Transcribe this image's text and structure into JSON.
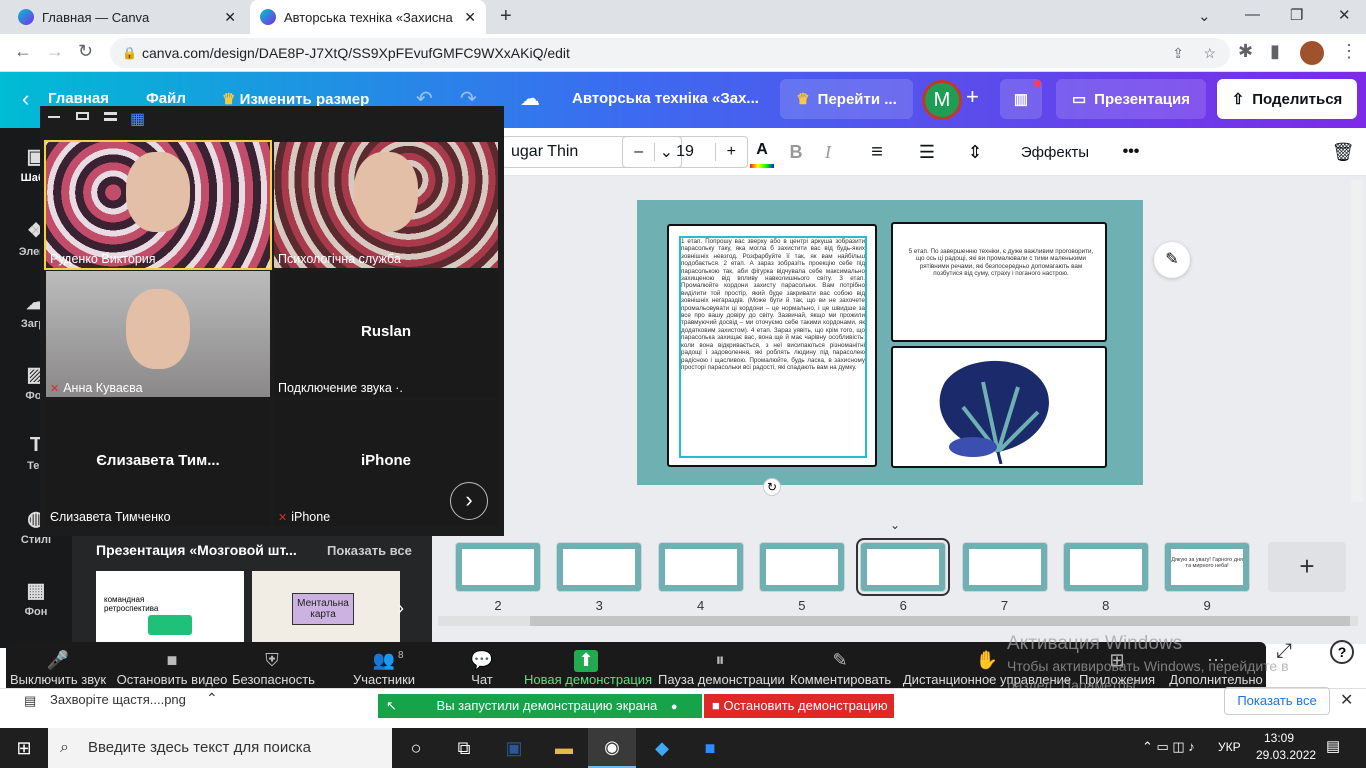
{
  "browser": {
    "tabs": [
      {
        "title": "Главная — Canva"
      },
      {
        "title": "Авторська техніка «Захисна пар"
      }
    ],
    "url": "canva.com/design/DAE8P-J7XtQ/SS9XpFEvufGMFC9WXxAKiQ/edit",
    "new_tab": "+",
    "win_controls": [
      "⌄",
      "—",
      "❐",
      "✕"
    ]
  },
  "canva": {
    "back": "‹",
    "home": "Главная",
    "file": "Файл",
    "resize": "Изменить размер",
    "doc_title": "Авторська техніка «Зах...",
    "upgrade": "Перейти ...",
    "avatar_letter": "M",
    "add": "+",
    "present": "Презентация",
    "share": "Поделиться",
    "toolbar": {
      "font": "ugar Thin",
      "minus": "–",
      "size": "19",
      "plus": "+",
      "text_color": "A",
      "bold": "B",
      "italic": "I",
      "effects": "Эффекты",
      "more": "•••"
    },
    "rail": [
      {
        "label": "Шабл"
      },
      {
        "label": "Элеме"
      },
      {
        "label": "Загру"
      },
      {
        "label": "Фот"
      },
      {
        "label": "Тек"
      },
      {
        "label": "Стилі"
      },
      {
        "label": "Фон"
      }
    ],
    "slide": {
      "left_text": "1 етап. Попрошу вас зверху або в центрі аркуша зобразити парасольку таку, яка могла б захистити вас від будь-яких зовнішніх невзгод. Розфарбуйте її так, як вам найбільш подобається. 2 етап. А зараз зобразіть проекцію себе під парасолькою так, аби фігурка відчувала себе максимально захищеною від впливу навколишнього світу. 3 етап. Промалюйте кордони захисту парасольки. Вам потрібно виділити той простір, який буде закривати вас собою від зовнішніх негараздів. (Може бути й так, що ви не захочете промальовувати ці кордони – це нормально, і це швидше за все про вашу довіру до світу. Зазвичай, якщо ми прожили травмуючий досвід – ми оточуємо себе такими кордонами, як додатковим захистом). 4 етап. Зараз уявіть, що крім того, що парасолька захищає вас, вона ще й має чарівну особливість: коли вона відкривається, з неї висипаються різноманітні радощі і задоволення, які роблять людину під парасолею радісною і щасливою. Промалюйте, будь ласка, в захисному просторі парасольки всі радості, які спадають вам на думку.",
      "right_text": "5 етап. По завершенню техніки, є дуже важливим проговорити, що ось ці радощі, які ви промалювали с тими маленькими рятівними речами, які безпосередньо допомагають вам позбутися від суму, страху і поганого настрою."
    },
    "filmstrip": {
      "pages": [
        "2",
        "3",
        "4",
        "5",
        "6",
        "7",
        "8",
        "9"
      ],
      "current": "6",
      "last_thumb_text": "Дякую за увагу! Гарного дня та мирного неба!",
      "add": "+"
    }
  },
  "presentation_panel": {
    "title": "Презентация «Мозговой шт...",
    "show_all": "Показать все",
    "card1_title": "командная ретроспектива",
    "card2_title": "Ментальна карта"
  },
  "zoom": {
    "participants": [
      {
        "name": "Руденко Виктория",
        "big": ""
      },
      {
        "name": "Психологічна служба",
        "big": ""
      },
      {
        "name": "Анна Куваєва",
        "big": ""
      },
      {
        "name": "Подключение звука ·.",
        "big": "Ruslan"
      },
      {
        "name": "Єлизавета Тимченко",
        "big": "Єлизавета Тим..."
      },
      {
        "name": "iPhone",
        "big": "iPhone"
      }
    ],
    "controls": [
      "Выключить звук",
      "Остановить видео",
      "Безопасность",
      "Участники",
      "Чат",
      "Новая демонстрация",
      "Пауза демонстрации",
      "Комментировать",
      "Дистанционное управление",
      "Приложения",
      "Дополнительно"
    ],
    "participants_count": "8",
    "sharing_msg": "Вы запустили демонстрацию экрана",
    "stop_share": "Остановить демонстрацию"
  },
  "windows": {
    "activation_title": "Активация Windows",
    "activation_sub": "Чтобы активировать Windows, перейдите в раздел \"Параметры\"."
  },
  "download": {
    "file": "Захворіте щастя....png",
    "show_all": "Показать все"
  },
  "taskbar": {
    "search": "Введите здесь текст для поиска",
    "lang": "УКР",
    "time": "13:09",
    "date": "29.03.2022"
  },
  "colors": {
    "slide_bg": "#6fb0b2",
    "share_green": "#16a34a",
    "stop_red": "#e02828",
    "canva_purple": "#7d2ae8"
  }
}
